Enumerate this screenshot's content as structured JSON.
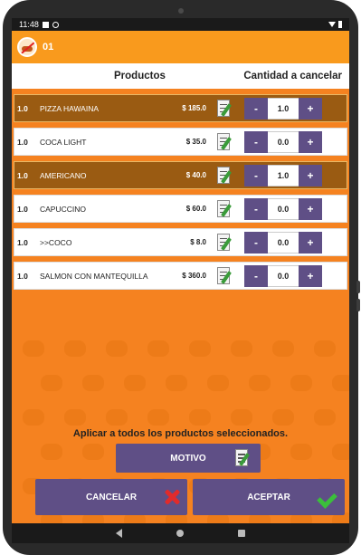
{
  "status": {
    "time": "11:48"
  },
  "header": {
    "table": "01"
  },
  "columns": {
    "products": "Productos",
    "cancel_qty": "Cantidad a cancelar"
  },
  "rows": [
    {
      "qty": "1.0",
      "name": "PIZZA HAWAINA",
      "price": "$ 185.0",
      "value": "1.0",
      "selected": true
    },
    {
      "qty": "1.0",
      "name": "COCA LIGHT",
      "price": "$ 35.0",
      "value": "0.0",
      "selected": false
    },
    {
      "qty": "1.0",
      "name": "AMERICANO",
      "price": "$ 40.0",
      "value": "1.0",
      "selected": true
    },
    {
      "qty": "1.0",
      "name": "CAPUCCINO",
      "price": "$ 60.0",
      "value": "0.0",
      "selected": false
    },
    {
      "qty": "1.0",
      "name": ">>COCO",
      "price": "$ 8.0",
      "value": "0.0",
      "selected": false
    },
    {
      "qty": "1.0",
      "name": "SALMON CON MANTEQUILLA",
      "price": "$ 360.0",
      "value": "0.0",
      "selected": false
    }
  ],
  "stepper": {
    "minus": "-",
    "plus": "+"
  },
  "footer": {
    "apply_all": "Aplicar a todos los productos seleccionados.",
    "motivo": "MOTIVO",
    "cancel": "CANCELAR",
    "accept": "ACEPTAR"
  },
  "colors": {
    "primary_bg": "#f58220",
    "selected_row": "#9a5b12",
    "button": "#5f4f86"
  }
}
